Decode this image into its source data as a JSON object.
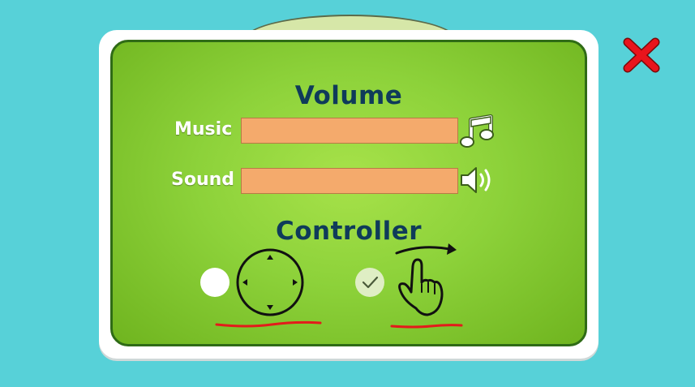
{
  "volume": {
    "title": "Volume",
    "music_label": "Music",
    "sound_label": "Sound",
    "music_icon": "music-note-icon",
    "sound_icon": "speaker-icon"
  },
  "controller": {
    "title": "Controller",
    "options": [
      {
        "icon": "dpad-joystick-icon",
        "selected": false
      },
      {
        "icon": "swipe-hand-icon",
        "selected": true
      }
    ]
  },
  "close_icon": "close-icon",
  "colors": {
    "background": "#57d1d8",
    "panel_green": "#8dd23a",
    "slider": "#f4aa6c",
    "heading": "#0f3b5a",
    "close": "#e8141c",
    "underline": "#e31b1b"
  }
}
